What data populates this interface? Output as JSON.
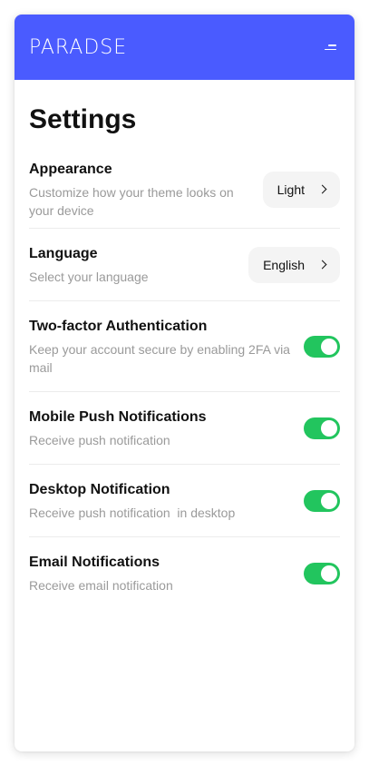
{
  "brand": {
    "logo_text": "PARADSE",
    "header_color": "#4A5BFF",
    "menu_icon": "hamburger-menu-icon"
  },
  "page": {
    "title": "Settings"
  },
  "settings": [
    {
      "key": "appearance",
      "title": "Appearance",
      "description": "Customize how your theme looks on your device",
      "control": "select",
      "value": "Light"
    },
    {
      "key": "language",
      "title": "Language",
      "description": "Select your language",
      "control": "select",
      "value": "English"
    },
    {
      "key": "two_factor",
      "title": "Two-factor Authentication",
      "description": "Keep your account secure by enabling 2FA via mail",
      "control": "toggle",
      "enabled": true
    },
    {
      "key": "mobile_push",
      "title": "Mobile Push Notifications",
      "description": "Receive push notification",
      "control": "toggle",
      "enabled": true
    },
    {
      "key": "desktop_notification",
      "title": "Desktop Notification",
      "description": "Receive push notification  in desktop",
      "control": "toggle",
      "enabled": true
    },
    {
      "key": "email_notifications",
      "title": "Email Notifications",
      "description": "Receive email notification",
      "control": "toggle",
      "enabled": true
    }
  ],
  "colors": {
    "toggle_on": "#22c55e",
    "pill_bg": "#f4f4f4"
  }
}
